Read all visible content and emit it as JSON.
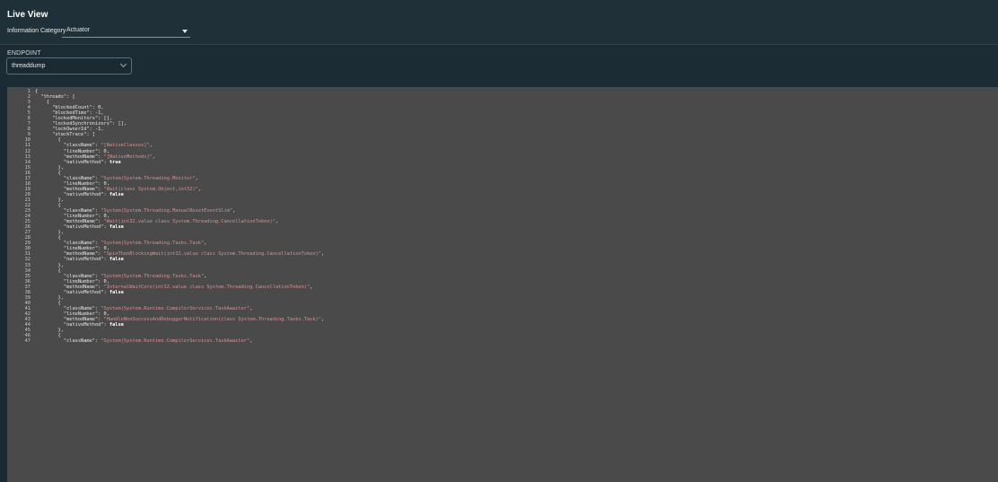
{
  "header": {
    "title": "Live View",
    "category_label": "Information Category",
    "category_value": "Actuator"
  },
  "endpoint": {
    "label": "ENDPOINT",
    "value": "threaddump"
  },
  "editor": {
    "lines": [
      [
        {
          "t": "{"
        }
      ],
      [
        {
          "t": "  \"threads\": ["
        }
      ],
      [
        {
          "t": "    {"
        }
      ],
      [
        {
          "t": "      \"blockedCount\": 0,"
        }
      ],
      [
        {
          "t": "      \"blockedTime\": -1,"
        }
      ],
      [
        {
          "t": "      \"lockedMonitors\": [],"
        }
      ],
      [
        {
          "t": "      \"lockedSynchronizers\": [],"
        }
      ],
      [
        {
          "t": "      \"lockOwnerId\": -1,"
        }
      ],
      [
        {
          "t": "      \"stackTrace\": ["
        }
      ],
      [
        {
          "t": "        {"
        }
      ],
      [
        {
          "t": "          \"className\": "
        },
        {
          "t": "\"[NativeClasses]\"",
          "c": "s"
        },
        {
          "t": ","
        }
      ],
      [
        {
          "t": "          \"lineNumber\": 0,"
        }
      ],
      [
        {
          "t": "          \"methodName\": "
        },
        {
          "t": "\"[NativeMethods]\"",
          "c": "s"
        },
        {
          "t": ","
        }
      ],
      [
        {
          "t": "          \"nativeMethod\": "
        },
        {
          "t": "true",
          "c": "b"
        }
      ],
      [
        {
          "t": "        },"
        }
      ],
      [
        {
          "t": "        {"
        }
      ],
      [
        {
          "t": "          \"className\": "
        },
        {
          "t": "\"System|System.Threading.Monitor\"",
          "c": "s"
        },
        {
          "t": ","
        }
      ],
      [
        {
          "t": "          \"lineNumber\": 0,"
        }
      ],
      [
        {
          "t": "          \"methodName\": "
        },
        {
          "t": "\"Wait(class System.Object,int32)\"",
          "c": "s"
        },
        {
          "t": ","
        }
      ],
      [
        {
          "t": "          \"nativeMethod\": "
        },
        {
          "t": "false",
          "c": "b"
        }
      ],
      [
        {
          "t": "        },"
        }
      ],
      [
        {
          "t": "        {"
        }
      ],
      [
        {
          "t": "          \"className\": "
        },
        {
          "t": "\"System|System.Threading.ManualResetEventSlim\"",
          "c": "s"
        },
        {
          "t": ","
        }
      ],
      [
        {
          "t": "          \"lineNumber\": 0,"
        }
      ],
      [
        {
          "t": "          \"methodName\": "
        },
        {
          "t": "\"Wait(int32,value class System.Threading.CancellationToken)\"",
          "c": "s"
        },
        {
          "t": ","
        }
      ],
      [
        {
          "t": "          \"nativeMethod\": "
        },
        {
          "t": "false",
          "c": "b"
        }
      ],
      [
        {
          "t": "        },"
        }
      ],
      [
        {
          "t": "        {"
        }
      ],
      [
        {
          "t": "          \"className\": "
        },
        {
          "t": "\"System|System.Threading.Tasks.Task\"",
          "c": "s"
        },
        {
          "t": ","
        }
      ],
      [
        {
          "t": "          \"lineNumber\": 0,"
        }
      ],
      [
        {
          "t": "          \"methodName\": "
        },
        {
          "t": "\"SpinThenBlockingWait(int32,value class System.Threading.CancellationToken)\"",
          "c": "s"
        },
        {
          "t": ","
        }
      ],
      [
        {
          "t": "          \"nativeMethod\": "
        },
        {
          "t": "false",
          "c": "b"
        }
      ],
      [
        {
          "t": "        },"
        }
      ],
      [
        {
          "t": "        {"
        }
      ],
      [
        {
          "t": "          \"className\": "
        },
        {
          "t": "\"System|System.Threading.Tasks.Task\"",
          "c": "s"
        },
        {
          "t": ","
        }
      ],
      [
        {
          "t": "          \"lineNumber\": 0,"
        }
      ],
      [
        {
          "t": "          \"methodName\": "
        },
        {
          "t": "\"InternalWaitCore(int32,value class System.Threading.CancellationToken)\"",
          "c": "s"
        },
        {
          "t": ","
        }
      ],
      [
        {
          "t": "          \"nativeMethod\": "
        },
        {
          "t": "false",
          "c": "b"
        }
      ],
      [
        {
          "t": "        },"
        }
      ],
      [
        {
          "t": "        {"
        }
      ],
      [
        {
          "t": "          \"className\": "
        },
        {
          "t": "\"System|System.Runtime.CompilerServices.TaskAwaiter\"",
          "c": "s"
        },
        {
          "t": ","
        }
      ],
      [
        {
          "t": "          \"lineNumber\": 0,"
        }
      ],
      [
        {
          "t": "          \"methodName\": "
        },
        {
          "t": "\"HandleNonSuccessAndDebuggerNotification(class System.Threading.Tasks.Task)\"",
          "c": "s"
        },
        {
          "t": ","
        }
      ],
      [
        {
          "t": "          \"nativeMethod\": "
        },
        {
          "t": "false",
          "c": "b"
        }
      ],
      [
        {
          "t": "        },"
        }
      ],
      [
        {
          "t": "        {"
        }
      ],
      [
        {
          "t": "          \"className\": "
        },
        {
          "t": "\"System|System.Runtime.CompilerServices.TaskAwaiter\"",
          "c": "s"
        },
        {
          "t": ","
        }
      ]
    ]
  }
}
